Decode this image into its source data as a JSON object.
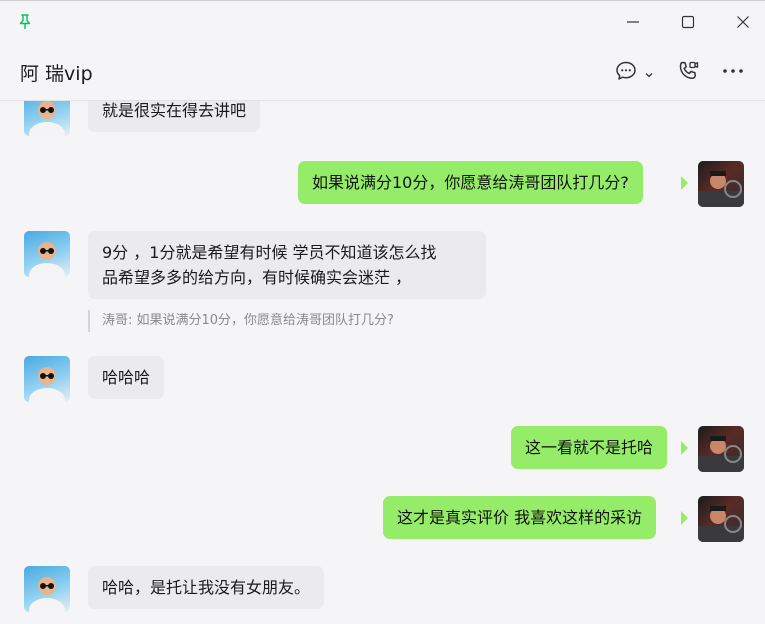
{
  "window": {
    "pin_icon": "pin-icon",
    "minimize_icon": "minimize-icon",
    "maximize_icon": "maximize-icon",
    "close_icon": "close-icon"
  },
  "header": {
    "title": "阿 瑞vip",
    "icons": [
      "chat-bubble-icon",
      "chevron-down-icon",
      "phone-video-icon",
      "more-icon"
    ]
  },
  "colors": {
    "self_bubble": "#95ec69",
    "other_bubble": "#ebebed",
    "background": "#f5f5f7",
    "pin_accent": "#07c160"
  },
  "messages": [
    {
      "side": "left",
      "text": "就是很实在得去讲吧"
    },
    {
      "side": "right",
      "text": "如果说满分10分，你愿意给涛哥团队打几分?"
    },
    {
      "side": "left",
      "line1": "9分 ，1分就是希望有时候  学员不知道该怎么找",
      "line2": "品希望多多的给方向，有时候确实会迷茫 ，",
      "quote": "涛哥: 如果说满分10分，你愿意给涛哥团队打几分?"
    },
    {
      "side": "left",
      "text": "哈哈哈"
    },
    {
      "side": "right",
      "text": "这一看就不是托哈"
    },
    {
      "side": "right",
      "text": "这才是真实评价 我喜欢这样的采访"
    },
    {
      "side": "left",
      "text": "哈哈，是托让我没有女朋友。"
    }
  ]
}
